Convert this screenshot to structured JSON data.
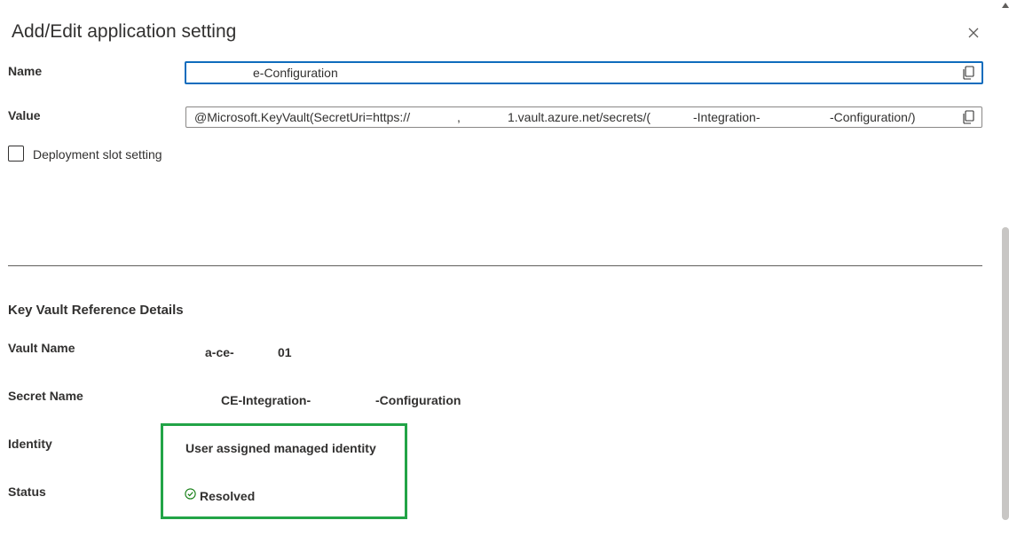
{
  "dialog": {
    "title": "Add/Edit application setting",
    "close_icon": "close-icon"
  },
  "form": {
    "name_label": "Name",
    "name_value_fragment": "e-Configuration",
    "value_label": "Value",
    "value_parts": [
      "@Microsoft.KeyVault(SecretUri=https://",
      ",",
      "1.vault.azure.net/secrets/(",
      "-Integration-",
      "-Configuration/)"
    ],
    "deployment_slot_label": "Deployment slot setting",
    "deployment_slot_checked": false
  },
  "details": {
    "heading": "Key Vault Reference Details",
    "vault_name_label": "Vault Name",
    "vault_name_parts": [
      "a-ce-",
      "01"
    ],
    "secret_name_label": "Secret Name",
    "secret_name_parts": [
      "CE-Integration-",
      "-Configuration"
    ],
    "identity_label": "Identity",
    "identity_value": "User assigned managed identity",
    "status_label": "Status",
    "status_value": "Resolved"
  },
  "colors": {
    "focus_border": "#0f6cbd",
    "highlight_box": "#22a447",
    "resolved_icon": "#107c10"
  }
}
